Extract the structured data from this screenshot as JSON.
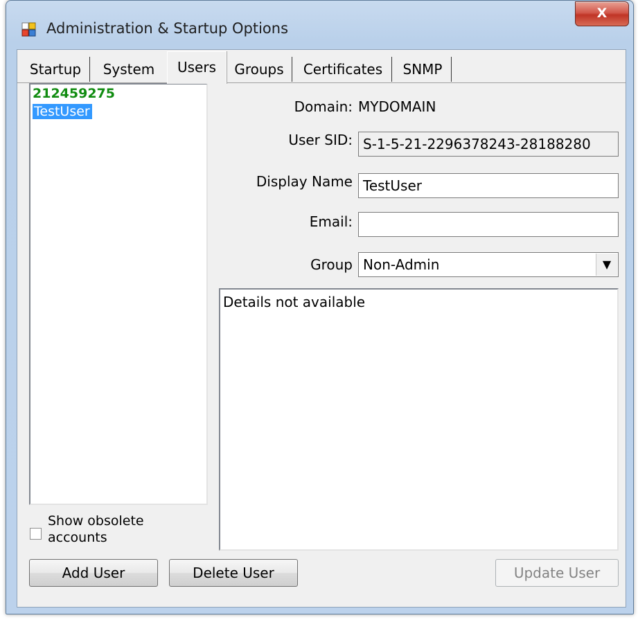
{
  "window": {
    "title": "Administration & Startup Options",
    "close_label": "X"
  },
  "tabs": [
    {
      "label": "Startup",
      "active": false
    },
    {
      "label": "System",
      "active": false
    },
    {
      "label": "Users",
      "active": true
    },
    {
      "label": "Groups",
      "active": false
    },
    {
      "label": "Certificates",
      "active": false
    },
    {
      "label": "SNMP",
      "active": false
    }
  ],
  "user_list": {
    "items": [
      {
        "label": "212459275",
        "style": "admin",
        "color": "#118c11"
      },
      {
        "label": "TestUser",
        "style": "selected"
      }
    ]
  },
  "show_obsolete": {
    "label": "Show obsolete accounts",
    "checked": false
  },
  "form": {
    "domain_label": "Domain:",
    "domain_value": "MYDOMAIN",
    "sid_label": "User SID:",
    "sid_value": "S-1-5-21-2296378243-28188280",
    "display_name_label": "Display Name",
    "display_name_value": "TestUser",
    "email_label": "Email:",
    "email_value": "",
    "group_label": "Group",
    "group_value": "Non-Admin"
  },
  "details_text": "Details not available",
  "buttons": {
    "add_user": "Add User",
    "delete_user": "Delete User",
    "update_user": "Update User"
  },
  "colors": {
    "selection": "#3399ff",
    "admin_user": "#118c11",
    "close_button": "#c03526"
  }
}
